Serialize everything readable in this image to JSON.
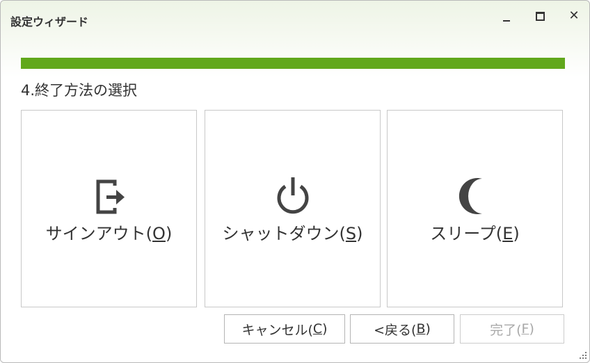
{
  "window": {
    "title": "設定ウィザード",
    "minimize_icon": "minimize-icon",
    "maximize_icon": "maximize-icon",
    "close_icon": "close-icon",
    "close_glyph": "✕"
  },
  "progress": {
    "value_fraction": 1.0,
    "color": "#61a81c"
  },
  "step": {
    "title": "4.終了方法の選択"
  },
  "options": [
    {
      "label": "サインアウト(",
      "mnemonic": "O",
      "suffix": ")",
      "icon": "sign-out-icon"
    },
    {
      "label": "シャットダウン(",
      "mnemonic": "S",
      "suffix": ")",
      "icon": "power-icon"
    },
    {
      "label": "スリープ(",
      "mnemonic": "E",
      "suffix": ")",
      "icon": "moon-icon"
    }
  ],
  "buttons": {
    "cancel": {
      "label": "キャンセル(",
      "mnemonic": "C",
      "suffix": ")"
    },
    "back": {
      "label": "<戻る(",
      "mnemonic": "B",
      "suffix": ")"
    },
    "finish": {
      "label": "完了(",
      "mnemonic": "F",
      "suffix": ")",
      "enabled": false
    }
  },
  "colors": {
    "accent": "#61a81c",
    "icon": "#444444",
    "text": "#333333",
    "disabled_text": "#a8a8a8"
  }
}
